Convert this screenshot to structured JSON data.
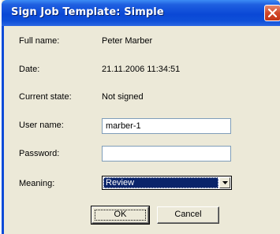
{
  "window": {
    "title": "Sign Job Template: Simple"
  },
  "fields": {
    "full_name_label": "Full name:",
    "full_name_value": "Peter Marber",
    "date_label": "Date:",
    "date_value": "21.11.2006 11:34:51",
    "state_label": "Current state:",
    "state_value": "Not signed",
    "user_name_label": "User name:",
    "user_name_value": "marber-1",
    "password_label": "Password:",
    "password_value": "",
    "meaning_label": "Meaning:",
    "meaning_value": "Review"
  },
  "buttons": {
    "ok_label": "OK",
    "cancel_label": "Cancel"
  },
  "icons": {
    "close": "close-icon",
    "dropdown": "chevron-down-icon"
  },
  "colors": {
    "titlebar": "#0a48d6",
    "dialog_bg": "#ece9d8",
    "close_button": "#d1482a",
    "selection": "#0a246a"
  }
}
